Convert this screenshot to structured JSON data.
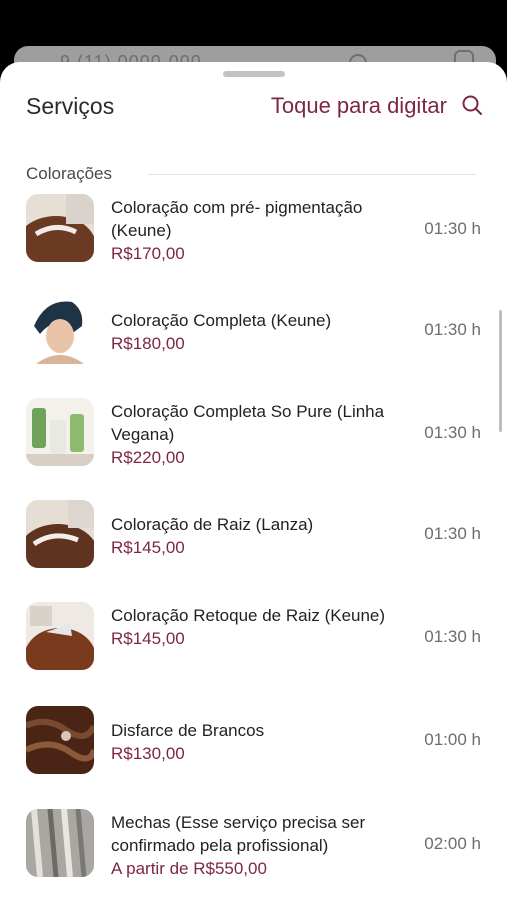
{
  "background_app": {
    "masked_phone": "9 (11) 0000-000"
  },
  "sheet": {
    "title": "Serviços",
    "search_hint": "Toque para digitar",
    "section_label": "Colorações"
  },
  "services": [
    {
      "name": "Coloração com pré- pigmentação (Keune)",
      "price": "R$170,00",
      "duration": "01:30 h"
    },
    {
      "name": "Coloração Completa (Keune)",
      "price": "R$180,00",
      "duration": "01:30 h"
    },
    {
      "name": "Coloração Completa So Pure (Linha Vegana)",
      "price": "R$220,00",
      "duration": "01:30 h"
    },
    {
      "name": "Coloração de Raiz (Lanza)",
      "price": "R$145,00",
      "duration": "01:30 h"
    },
    {
      "name": "Coloração Retoque de Raiz (Keune)",
      "price": "R$145,00",
      "duration": "01:30 h"
    },
    {
      "name": "Disfarce de Brancos",
      "price": "R$130,00",
      "duration": "01:00 h"
    },
    {
      "name": "Mechas (Esse serviço precisa ser confirmado pela profissional)",
      "price": "A partir de R$550,00",
      "duration": "02:00 h"
    }
  ],
  "colors": {
    "accent": "#7e2744",
    "text": "#222222",
    "muted": "#6d6d6d"
  },
  "icons": {
    "search": "search-icon",
    "phone": "phone-icon",
    "contact": "contact-icon"
  }
}
